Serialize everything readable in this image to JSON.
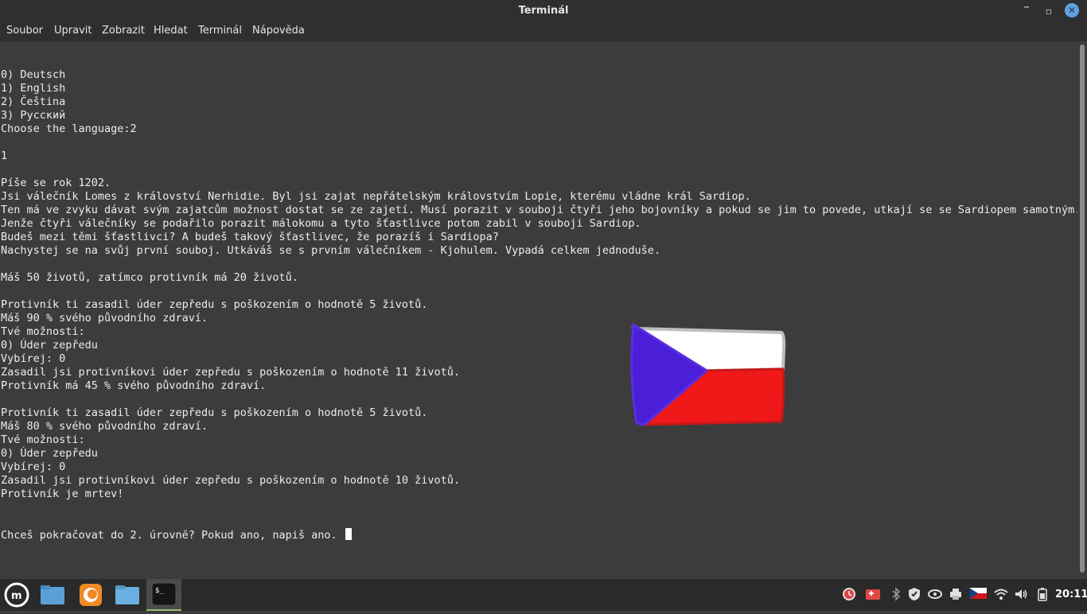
{
  "window": {
    "title": "Terminál",
    "minimize_glyph": "‾",
    "maximize_glyph": "▫",
    "close_glyph": "✕"
  },
  "menu": {
    "items": [
      "Soubor",
      "Upravit",
      "Zobrazit",
      "Hledat",
      "Terminál",
      "Nápověda"
    ]
  },
  "terminal": {
    "lines": [
      "0) Deutsch",
      "1) English",
      "2) Čeština",
      "3) Русский",
      "Choose the language:2",
      "",
      "1",
      "",
      "Píše se rok 1202.",
      "Jsi válečník Lomes z království Nerhidie. Byl jsi zajat nepřátelským královstvím Lopie, kterému vládne král Sardiop.",
      "Ten má ve zvyku dávat svým zajatcům možnost dostat se ze zajetí. Musí porazit v souboji čtyři jeho bojovníky a pokud se jim to povede, utkají se se Sardiopem samotným.",
      "Jenže čtyři válečníky se podařilo porazit málokomu a tyto šťastlivce potom zabil v souboji Sardiop.",
      "Budeš mezi těmi šťastlivci? A budeš takový šťastlivec, že porazíš i Sardiopa?",
      "Nachystej se na svůj první souboj. Utkáváš se s prvním válečníkem - Kjohulem. Vypadá celkem jednoduše.",
      "",
      "Máš 50 životů, zatímco protivník má 20 životů.",
      "",
      "Protivník ti zasadil úder zepředu s poškozením o hodnotě 5 životů.",
      "Máš 90 % svého původního zdraví.",
      "Tvé možnosti:",
      "0) Úder zepředu",
      "Vybírej: 0",
      "Zasadil jsi protivníkovi úder zepředu s poškozením o hodnotě 11 životů.",
      "Protivník má 45 % svého původního zdraví.",
      "",
      "Protivník ti zasadil úder zepředu s poškozením o hodnotě 5 životů.",
      "Máš 80 % svého původního zdraví.",
      "Tvé možnosti:",
      "0) Úder zepředu",
      "Vybírej: 0",
      "Zasadil jsi protivníkovi úder zepředu s poškozením o hodnotě 10 životů.",
      "Protivník je mrtev!"
    ],
    "prompt_line": "Chceš pokračovat do 2. úrovně? Pokud ano, napiš ano. "
  },
  "taskbar": {
    "clock": "20:11",
    "apps": [
      "mint-menu",
      "files",
      "firefox",
      "file-manager",
      "terminal"
    ],
    "tray": [
      "timeshift-icon",
      "games-icon",
      "bluetooth-icon",
      "update-shield-icon",
      "nvidia-icon",
      "printer-icon",
      "keyboard-layout-flag-icon",
      "wifi-icon",
      "volume-icon",
      "battery-icon"
    ]
  },
  "colors": {
    "terminal_bg": "#3c3c3c",
    "text": "#ececec",
    "flag_blue": "#4b1fd8",
    "flag_white": "#ffffff",
    "flag_red": "#f01818"
  }
}
